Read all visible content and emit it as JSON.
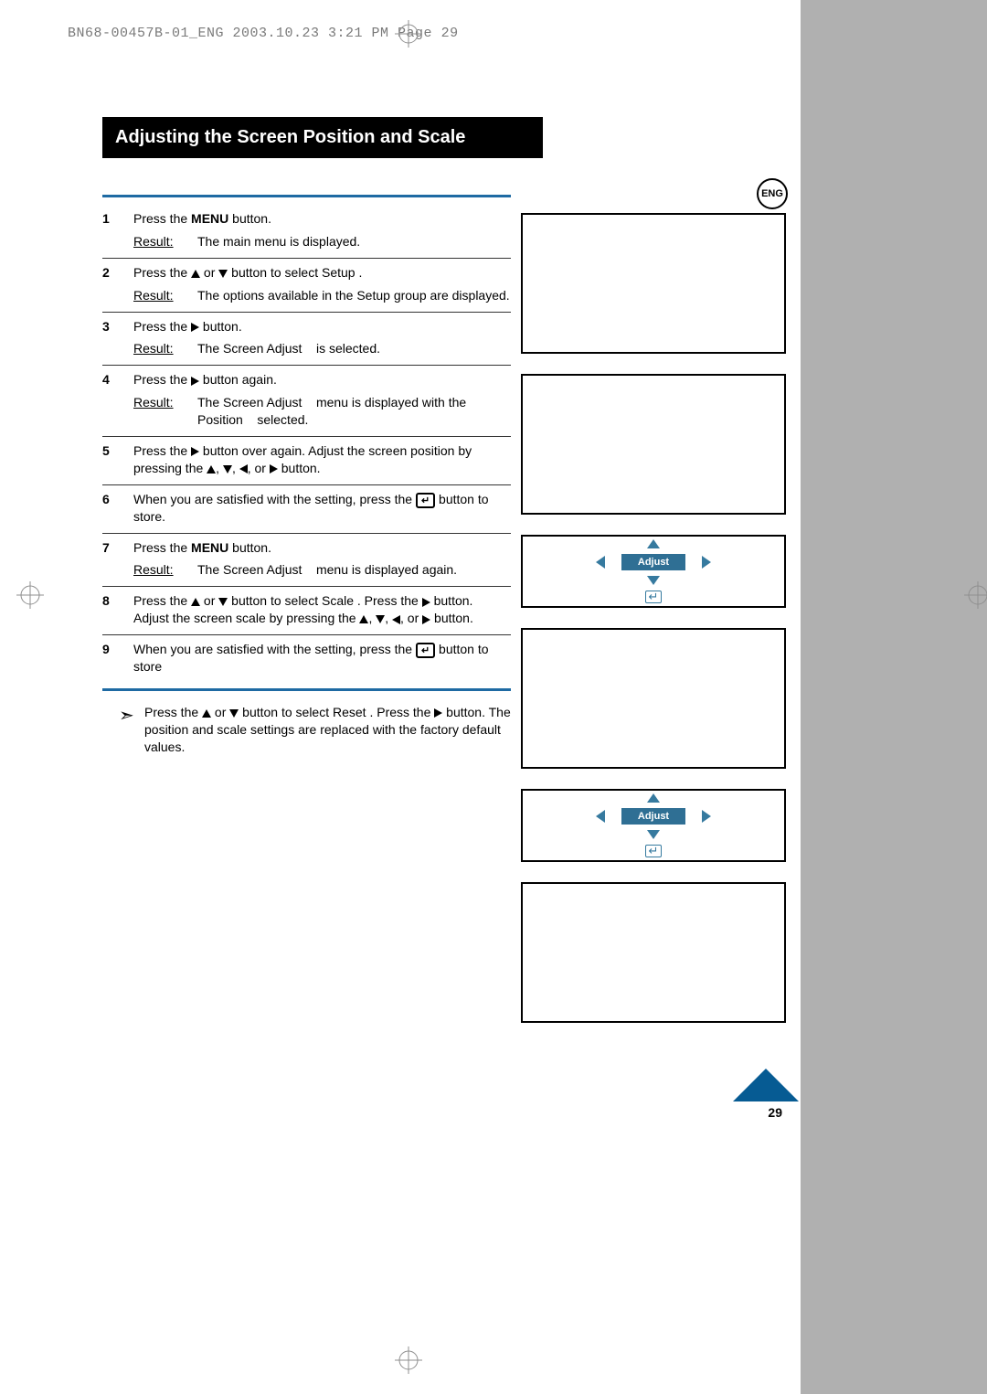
{
  "header_slug": "BN68-00457B-01_ENG  2003.10.23  3:21 PM  Page 29",
  "title": "Adjusting the Screen Position and Scale",
  "lang_badge": "ENG",
  "result_label": "Result:",
  "steps": {
    "s1": {
      "num": "1",
      "a": "Press the ",
      "b": "MENU",
      "c": " button.",
      "r": "The main menu is displayed."
    },
    "s2": {
      "num": "2",
      "a": "Press the ",
      "b": " or ",
      "c": " button to select Setup .",
      "r": "The options available in the Setup  group are displayed."
    },
    "s3": {
      "num": "3",
      "a": "Press the ",
      "b": " button.",
      "r1": "The Screen Adjust",
      "r2": "is selected."
    },
    "s4": {
      "num": "4",
      "a": "Press the ",
      "b": " button again.",
      "r1": "The Screen Adjust",
      "r2": "menu is displayed with the",
      "r3": "Position",
      "r4": "selected."
    },
    "s5": {
      "num": "5",
      "a": "Press the ",
      "b": " button over again. Adjust the screen position by pressing the ",
      "c": ", ",
      "d": ", ",
      "e": ", or ",
      "f": " button."
    },
    "s6": {
      "num": "6",
      "a": "When you are satisfied with the setting, press the ",
      "b": " button to store."
    },
    "s7": {
      "num": "7",
      "a": "Press the ",
      "b": "MENU",
      "c": " button.",
      "r1": "The Screen Adjust",
      "r2": "menu is displayed again."
    },
    "s8": {
      "num": "8",
      "a": "Press the ",
      "b": " or ",
      "c": " button to select Scale . Press the ",
      "d": " button. Adjust the screen scale by pressing the ",
      "e": ", ",
      "f": ", ",
      "g": ", or ",
      "h": " button."
    },
    "s9": {
      "num": "9",
      "a": "When you are satisfied with the setting, press the ",
      "b": " button to store"
    }
  },
  "note": {
    "a": "Press the ",
    "b": " or ",
    "c": " button to select Reset . Press the ",
    "d": " button. The position and scale settings are replaced with the factory default values."
  },
  "adjust_label": "Adjust",
  "page_number": "29"
}
